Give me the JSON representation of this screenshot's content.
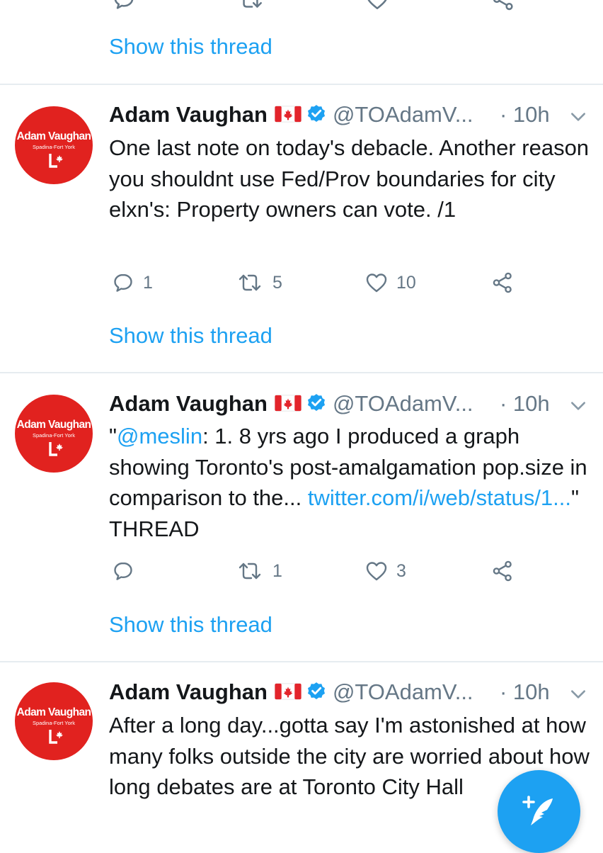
{
  "thread_link_label": "Show this thread",
  "colors": {
    "accent": "#1da1f2",
    "avatar_red": "#e1221f",
    "secondary_text": "#657786"
  },
  "avatar": {
    "name": "Adam Vaughan",
    "riding": "Spadina-Fort York"
  },
  "tweets": [
    {
      "author": "Adam Vaughan",
      "handle": "@TOAdamV...",
      "time": "· 10h",
      "body": "One last note on today's debacle. Another reason you shouldnt use Fed/Prov boundaries for city elxn's: Property owners can vote. /1",
      "replies": "1",
      "retweets": "5",
      "likes": "10"
    },
    {
      "author": "Adam Vaughan",
      "handle": "@TOAdamV...",
      "time": "· 10h",
      "body_parts": {
        "open_quote": "\"",
        "mention": "@meslin",
        "text": ": 1. 8 yrs ago I produced a graph showing Toronto's post-amalgamation pop.size in comparison to the... ",
        "link": "twitter.com/i/web/status/1...",
        "close": "\" THREAD"
      },
      "replies": "",
      "retweets": "1",
      "likes": "3"
    },
    {
      "author": "Adam Vaughan",
      "handle": "@TOAdamV...",
      "time": "· 10h",
      "body": "After a long day...gotta say I'm astonished at how many folks outside the city are worried about how long debates are at Toronto City Hall"
    }
  ],
  "icons": {
    "reply": "reply-icon",
    "retweet": "retweet-icon",
    "like": "heart-icon",
    "share": "share-icon",
    "more": "chevron-down-icon",
    "verified": "verified-badge-icon",
    "flag": "canada-flag-icon",
    "compose": "compose-tweet-icon"
  }
}
